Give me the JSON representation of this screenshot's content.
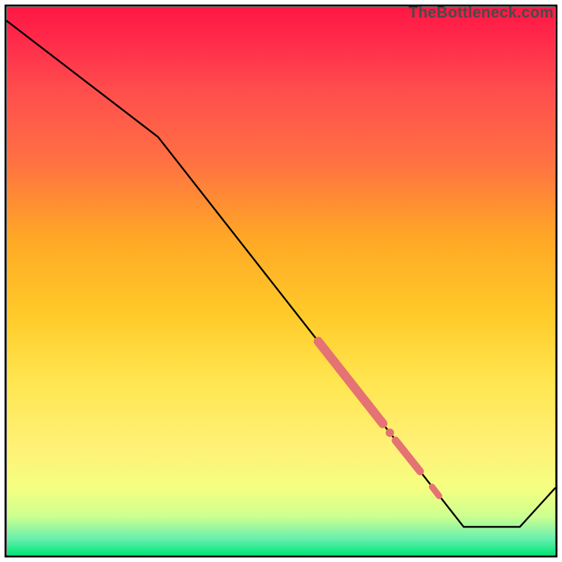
{
  "watermark": "TheBottleneck.com",
  "chart_data": {
    "type": "line",
    "title": "",
    "xlabel": "",
    "ylabel": "",
    "xlim": [
      10,
      790
    ],
    "ylim": [
      790,
      10
    ],
    "background_gradient": {
      "top_color": "#ff1744",
      "mid_color": "#ffeb3b",
      "bottom_color": "#00e676"
    },
    "series": [
      {
        "name": "curve",
        "color": "#000000",
        "points": [
          {
            "x": 10,
            "y": 30
          },
          {
            "x": 225,
            "y": 195
          },
          {
            "x": 660,
            "y": 750
          },
          {
            "x": 740,
            "y": 750
          },
          {
            "x": 790,
            "y": 695
          }
        ]
      }
    ],
    "highlight_segments": [
      {
        "name": "seg1",
        "color": "#e57373",
        "width": 13,
        "x1": 453,
        "y1": 486,
        "x2": 545,
        "y2": 603
      },
      {
        "name": "seg2",
        "color": "#e57373",
        "width": 11,
        "x1": 563,
        "y1": 627,
        "x2": 598,
        "y2": 671
      },
      {
        "name": "seg3",
        "color": "#e57373",
        "width": 9,
        "x1": 615,
        "y1": 693,
        "x2": 625,
        "y2": 706
      }
    ],
    "highlight_dots": [
      {
        "name": "dot1",
        "color": "#e57373",
        "r": 6,
        "cx": 555,
        "cy": 616
      }
    ]
  }
}
